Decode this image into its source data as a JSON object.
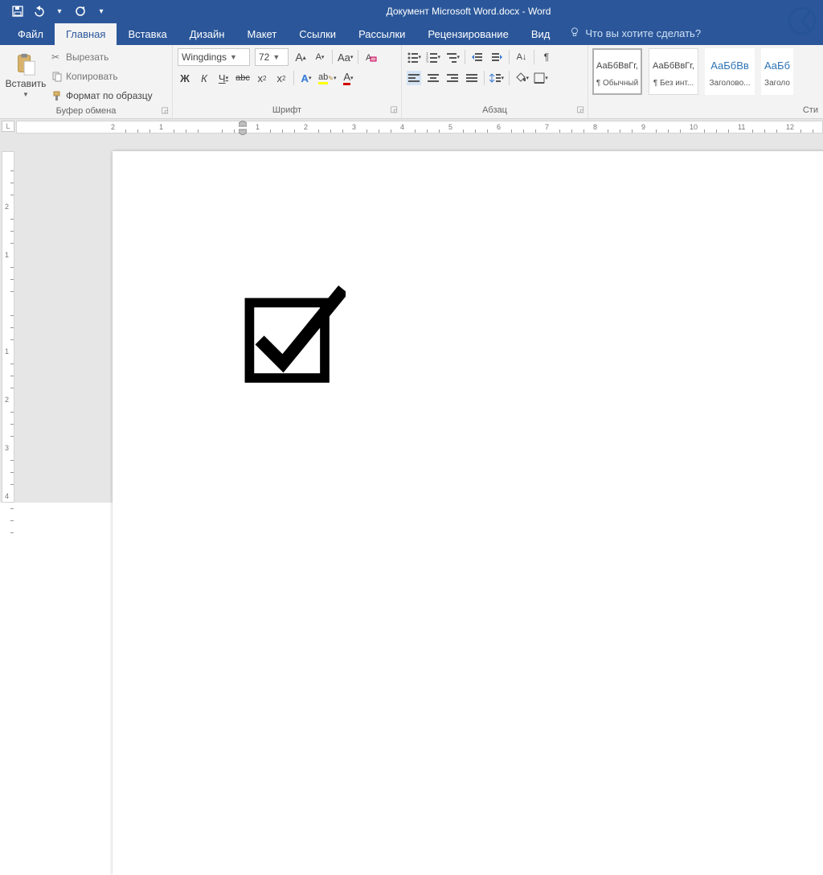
{
  "titlebar": {
    "title": "Документ Microsoft Word.docx - Word"
  },
  "qat": {
    "save": "save",
    "undo": "undo",
    "redo": "redo"
  },
  "tabs": {
    "items": [
      {
        "label": "Файл"
      },
      {
        "label": "Главная"
      },
      {
        "label": "Вставка"
      },
      {
        "label": "Дизайн"
      },
      {
        "label": "Макет"
      },
      {
        "label": "Ссылки"
      },
      {
        "label": "Рассылки"
      },
      {
        "label": "Рецензирование"
      },
      {
        "label": "Вид"
      }
    ],
    "active_index": 1,
    "tell_me": "Что вы хотите сделать?"
  },
  "ribbon": {
    "clipboard": {
      "paste": "Вставить",
      "cut": "Вырезать",
      "copy": "Копировать",
      "format_painter": "Формат по образцу",
      "group_label": "Буфер обмена"
    },
    "font": {
      "name": "Wingdings",
      "size": "72",
      "group_label": "Шрифт",
      "bold": "Ж",
      "italic": "К",
      "underline": "Ч",
      "strike": "abc",
      "subscript": "x₂",
      "superscript": "x²",
      "grow": "A",
      "shrink": "A",
      "case": "Aa",
      "clear": "A",
      "texteffects": "A",
      "highlight": "ab",
      "fontcolor": "A"
    },
    "paragraph": {
      "group_label": "Абзац",
      "pilcrow": "¶"
    },
    "styles": {
      "group_label": "Сти",
      "items": [
        {
          "preview": "АаБбВвГг,",
          "name": "¶ Обычный"
        },
        {
          "preview": "АаБбВвГг,",
          "name": "¶ Без инт..."
        },
        {
          "preview": "АаБбВв",
          "name": "Заголово..."
        },
        {
          "preview": "АаБб",
          "name": "Заголо"
        }
      ],
      "selected_index": 0
    }
  },
  "ruler": {
    "h_ticks": [
      "2",
      "1",
      "",
      "1",
      "2",
      "3",
      "4",
      "5",
      "6",
      "7",
      "8",
      "9",
      "10",
      "11",
      "12"
    ],
    "v_ticks": [
      "",
      "2",
      "1",
      "",
      "1",
      "2",
      "3",
      "4"
    ],
    "corner": "L"
  },
  "document": {
    "content_glyph": "☑",
    "font_px": 96
  },
  "colors": {
    "brand": "#2b579a",
    "ribbon_bg": "#f3f3f3",
    "heading_blue": "#2e74b5"
  }
}
